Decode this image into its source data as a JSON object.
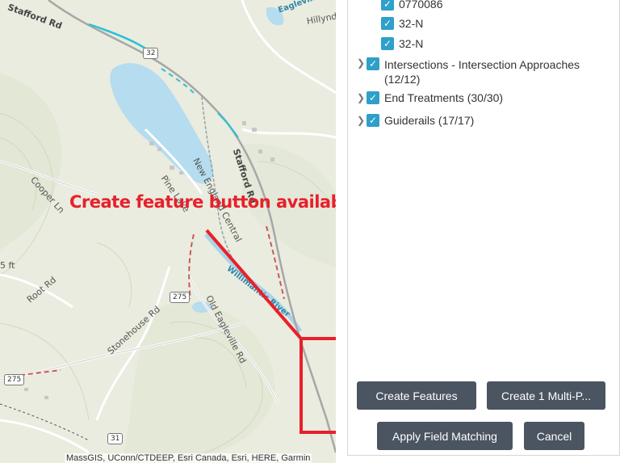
{
  "map": {
    "labels": {
      "stafford_rd_top": "Stafford Rd",
      "eagleville": "Eagleville",
      "hillyndale": "Hillynd",
      "route32": "32",
      "stafford_rd": "Stafford Rd",
      "new_england_central": "New England Central",
      "pine_lake": "Pine Lake",
      "cooper_ln": "Cooper Ln",
      "root_rd": "Root Rd",
      "route275a": "275",
      "route275b": "275",
      "old_eagleville_rd": "Old Eagleville Rd",
      "stonehouse_rd": "Stonehouse Rd",
      "willimantic_river": "Willimantic River",
      "ft": "5 ft",
      "route31": "31"
    },
    "attribution": "MassGIS, UConn/CTDEEP, Esri Canada, Esri, HERE, Garmin"
  },
  "annotation": {
    "text": "Create feature button available.",
    "color": "#e8202a"
  },
  "panel": {
    "layers": [
      {
        "label": "0770086",
        "checked": true,
        "expandable": false
      },
      {
        "label": "32-N",
        "checked": true,
        "expandable": false
      },
      {
        "label": "32-N",
        "checked": true,
        "expandable": false
      },
      {
        "label": "Intersections - Intersection Approaches",
        "label2": "(12/12)",
        "checked": true,
        "expandable": true
      },
      {
        "label": "End Treatments (30/30)",
        "checked": true,
        "expandable": true
      },
      {
        "label": "Guiderails (17/17)",
        "checked": true,
        "expandable": true
      }
    ],
    "buttons": {
      "create_features": "Create Features",
      "create_multi": "Create 1 Multi-P...",
      "apply_field_matching": "Apply Field Matching",
      "cancel": "Cancel"
    },
    "colors": {
      "checkbox": "#2ea0c9",
      "button_bg": "#4b5461"
    }
  }
}
